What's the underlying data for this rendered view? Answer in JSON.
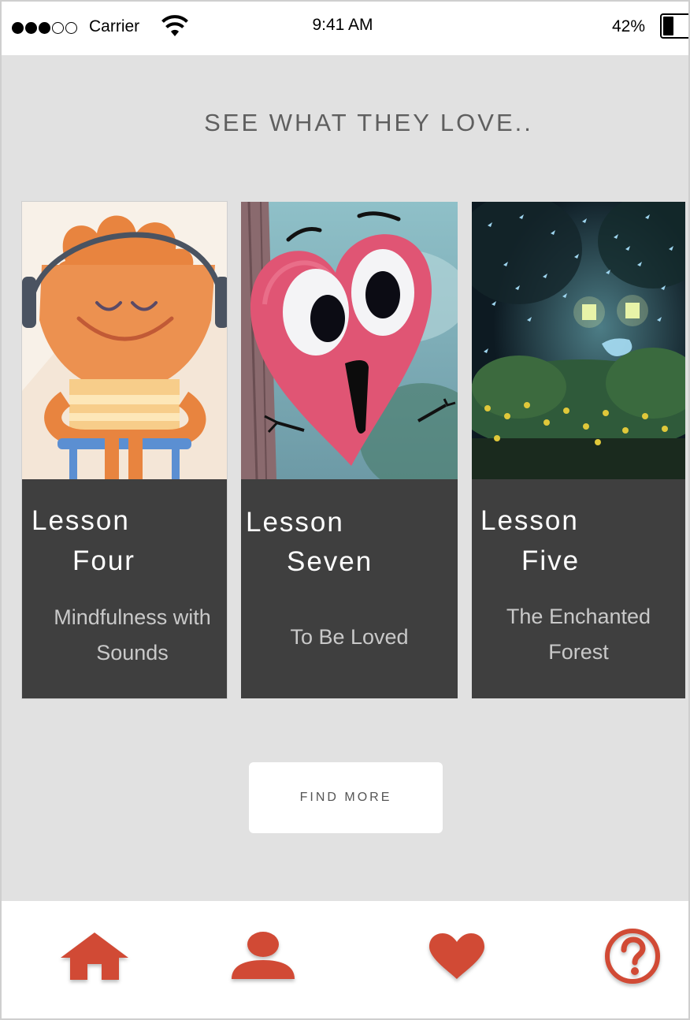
{
  "status_bar": {
    "carrier": "Carrier",
    "time": "9:41 AM",
    "battery": "42%",
    "battery_level": 0.42,
    "signal_bars_filled": 3,
    "signal_bars_total": 5
  },
  "main": {
    "title": "SEE WHAT THEY LOVE..",
    "cards": [
      {
        "line1": "Lesson",
        "line2": "Four",
        "subtitle_1": "Mindfulness with",
        "subtitle_2": "Sounds",
        "image": "meditating-character"
      },
      {
        "line1": "Lesson",
        "line2": "Seven",
        "subtitle_1": "To Be Loved",
        "subtitle_2": "",
        "image": "heart-character"
      },
      {
        "line1": "Lesson",
        "line2": "Five",
        "subtitle_1": "The Enchanted",
        "subtitle_2": "Forest",
        "image": "enchanted-forest"
      }
    ],
    "button_label": "FIND MORE"
  },
  "tab_bar": {
    "items": [
      {
        "icon": "home-icon"
      },
      {
        "icon": "profile-icon"
      },
      {
        "icon": "heart-icon"
      },
      {
        "icon": "help-icon"
      }
    ]
  },
  "colors": {
    "accent": "#d14a35",
    "background": "#e1e1e1",
    "card": "#3f3f3f"
  }
}
